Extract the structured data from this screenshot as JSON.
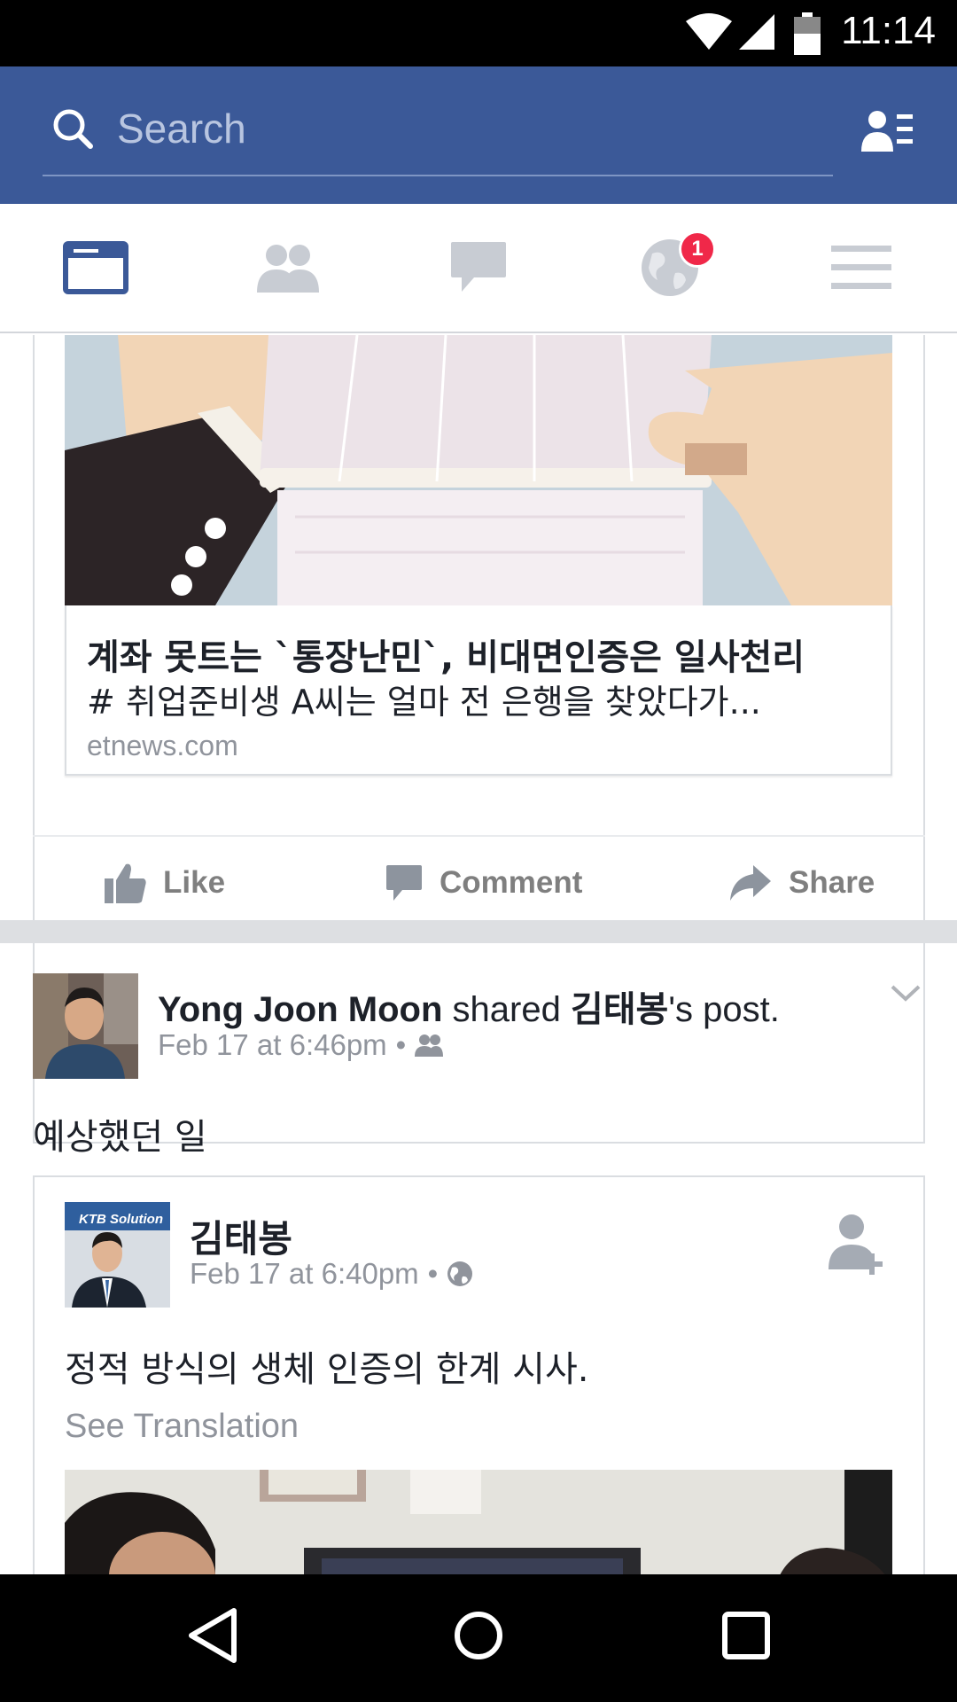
{
  "status_bar": {
    "time": "11:14"
  },
  "header": {
    "search": {
      "placeholder": "Search"
    }
  },
  "tabs": {
    "items": [
      {
        "name": "news-feed",
        "active": true
      },
      {
        "name": "friend-requests",
        "active": false
      },
      {
        "name": "messages",
        "active": false
      },
      {
        "name": "notifications",
        "active": false,
        "badge": "1"
      },
      {
        "name": "more",
        "active": false
      }
    ],
    "notification_badge": "1"
  },
  "shared_link": {
    "title": "계좌 못트는 `통장난민`, 비대면인증은 일사천리",
    "description": "# 취업준비생 A씨는 얼마 전 은행을 찾았다가...",
    "domain": "etnews.com"
  },
  "actions": {
    "like": "Like",
    "comment": "Comment",
    "share": "Share"
  },
  "post": {
    "author": "Yong Joon Moon",
    "verb": " shared ",
    "original_author": "김태봉",
    "suffix": "'s post.",
    "timestamp": "Feb 17 at 6:46pm",
    "dot": "•",
    "audience_icon": "friends-icon",
    "text": "예상했던 일",
    "shared_post": {
      "author": "김태봉",
      "timestamp": "Feb 17 at 6:40pm",
      "dot": "•",
      "audience_icon": "globe-icon",
      "text": "정적 방식의 생체 인증의 한계 시사.",
      "see_translation": "See Translation",
      "avatar_banner": "KTB Solution"
    }
  },
  "colors": {
    "brand": "#3b5998",
    "badge": "#f02849",
    "muted": "#90949c",
    "active_tab": "#3b5998",
    "inactive_tab": "#c8ccd3"
  }
}
